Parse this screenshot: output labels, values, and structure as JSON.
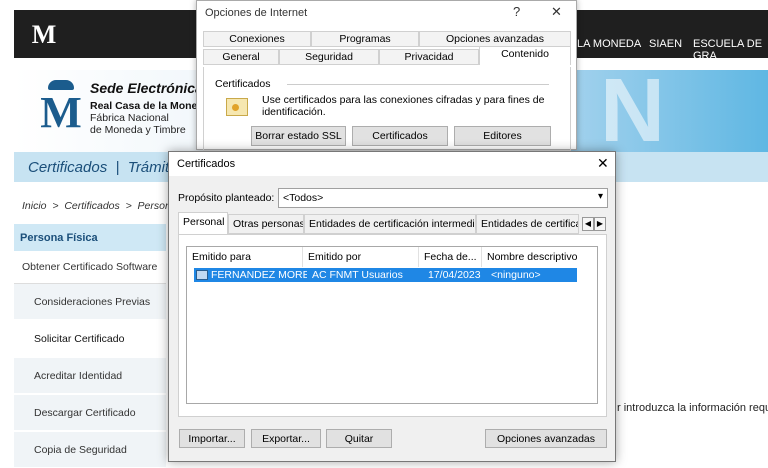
{
  "webpage": {
    "top_nav": [
      "LA MONEDA",
      "SIAEN",
      "ESCUELA DE GRA"
    ],
    "brand": {
      "title": "Sede Electrónica",
      "line1": "Real Casa de la Mone",
      "line2": "Fábrica Nacional",
      "line3": "de Moneda y Timbre"
    },
    "logo_letter": "M",
    "hero_deco": "N",
    "tabbar_text": "Certificados  |  Trámit",
    "breadcrumb": "Inicio  >  Certificados  >  Person",
    "sidebar": {
      "header": "Persona Física",
      "first": "Obtener Certificado Software",
      "items": [
        "Consideraciones Previas",
        "Solicitar Certificado",
        "Acreditar Identidad",
        "Descargar Certificado",
        "Copia de Seguridad"
      ]
    },
    "body_text": "r introduzca la información requ"
  },
  "internet_options": {
    "title": "Opciones de Internet",
    "help_glyph": "?",
    "close_glyph": "✕",
    "tabs_row1": [
      "Conexiones",
      "Programas",
      "Opciones avanzadas"
    ],
    "tabs_row2": [
      "General",
      "Seguridad",
      "Privacidad",
      "Contenido"
    ],
    "group_title": "Certificados",
    "description": "Use certificados para las conexiones cifradas y para fines de identificación.",
    "buttons": [
      "Borrar estado SSL",
      "Certificados",
      "Editores"
    ]
  },
  "cert_dialog": {
    "title": "Certificados",
    "close_glyph": "✕",
    "purpose_label": "Propósito planteado:",
    "purpose_value": "<Todos>",
    "tabs": [
      "Personal",
      "Otras personas",
      "Entidades de certificación intermedias",
      "Entidades de certificac"
    ],
    "columns": [
      "Emitido para",
      "Emitido por",
      "Fecha de...",
      "Nombre descriptivo"
    ],
    "rows": [
      {
        "issued_to": "FERNANDEZ MORE...",
        "issued_by": "AC FNMT Usuarios",
        "date": "17/04/2023",
        "friendly": "<ninguno>"
      }
    ],
    "buttons": {
      "import": "Importar...",
      "export": "Exportar...",
      "remove": "Quitar",
      "advanced": "Opciones avanzadas"
    }
  },
  "colors": {
    "selection": "#1f87e5",
    "site_blue": "#1b5c8d"
  }
}
